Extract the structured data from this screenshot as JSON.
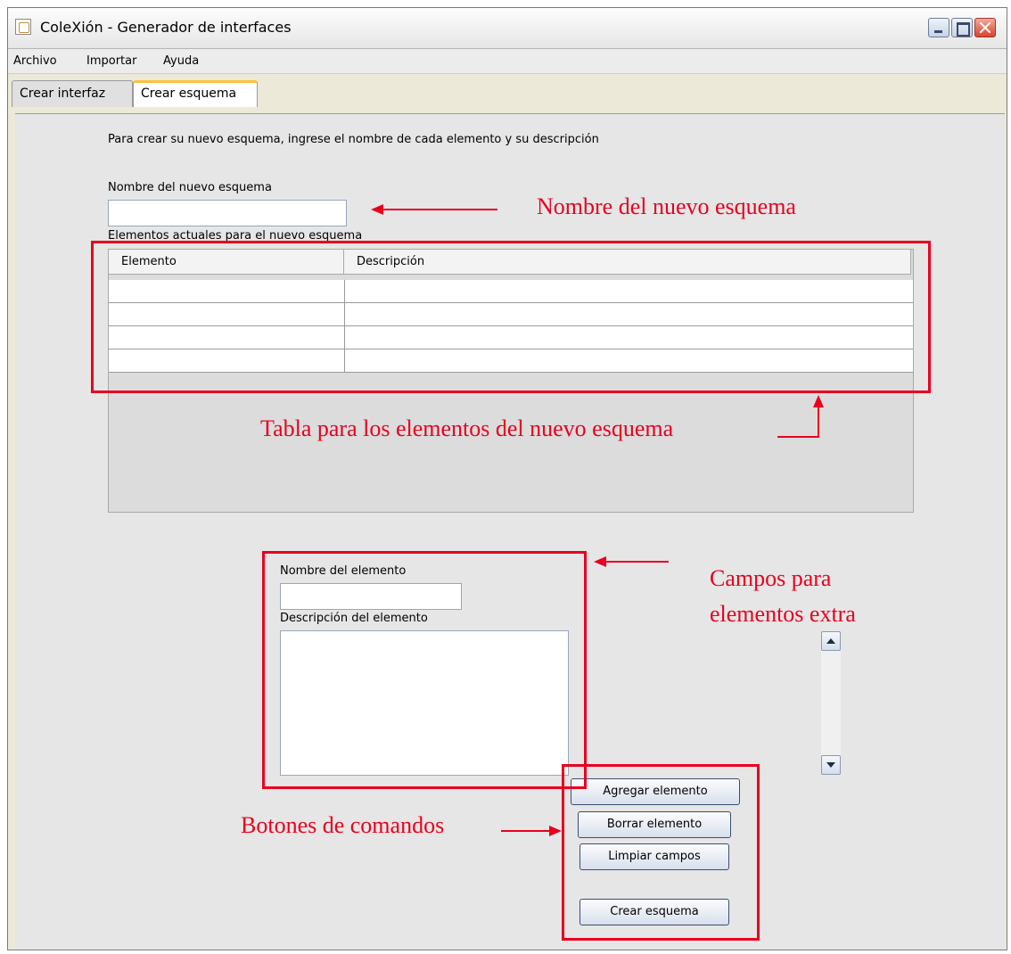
{
  "window": {
    "title": "ColeXión - Generador de interfaces"
  },
  "menu": {
    "items": [
      "Archivo",
      "Importar",
      "Ayuda"
    ]
  },
  "tabs": [
    {
      "label": "Crear interfaz",
      "active": false
    },
    {
      "label": "Crear esquema",
      "active": true
    }
  ],
  "form": {
    "instruction": "Para crear su nuevo esquema, ingrese el nombre de cada elemento y su descripción",
    "schema_name_label": "Nombre del nuevo esquema",
    "schema_name_value": "",
    "table_label": "Elementos actuales para el nuevo esquema",
    "table_columns": [
      "Elemento",
      "Descripción"
    ],
    "table_rows": [
      [
        "",
        ""
      ],
      [
        "",
        ""
      ],
      [
        "",
        ""
      ],
      [
        "",
        ""
      ]
    ],
    "element_name_label": "Nombre del elemento",
    "element_name_value": "",
    "element_desc_label": "Descripción del elemento",
    "element_desc_value": ""
  },
  "buttons": {
    "add": "Agregar elemento",
    "delete": "Borrar elemento",
    "clear": "Limpiar campos",
    "create": "Crear esquema"
  },
  "annotations": {
    "schema_name": "Nombre del nuevo esquema",
    "table": "Tabla para los elementos del nuevo esquema",
    "extra_fields_line1": "Campos para",
    "extra_fields_line2": "elementos extra",
    "commands": "Botones de comandos",
    "color": "#e8001e"
  },
  "colors": {
    "tab_active_accent": "#ffc03c",
    "button_border": "#3a4e72"
  }
}
